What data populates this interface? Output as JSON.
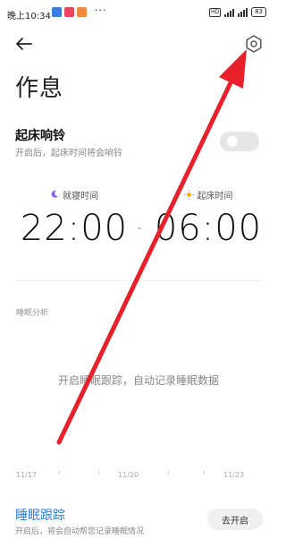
{
  "status_bar": {
    "time": "晚上10:34",
    "more": "···",
    "hd": "HD",
    "battery": "83"
  },
  "header": {
    "back_icon": "arrow-left-icon",
    "settings_icon": "gear-icon"
  },
  "page": {
    "title": "作息"
  },
  "alarm": {
    "title": "起床响铃",
    "subtitle": "开启后，起床时间将会响铃",
    "enabled": false
  },
  "schedule": {
    "bedtime_label": "就寝时间",
    "bedtime_value": "22:00",
    "bedtime_icon": "moon-icon",
    "wake_label": "起床时间",
    "wake_value": "06:00",
    "wake_icon": "sun-icon"
  },
  "analysis": {
    "label": "睡眠分析",
    "empty_text": "开启睡眠跟踪，自动记录睡眠数据",
    "axis_labels": [
      "11/17",
      "11/20",
      "11/23"
    ]
  },
  "tracking": {
    "title": "睡眠跟踪",
    "subtitle": "开启后，将会自动帮您记录睡眠情况",
    "button_label": "去开启"
  },
  "colors": {
    "accent": "#2f7de1",
    "annotation_arrow": "#e8202a"
  }
}
